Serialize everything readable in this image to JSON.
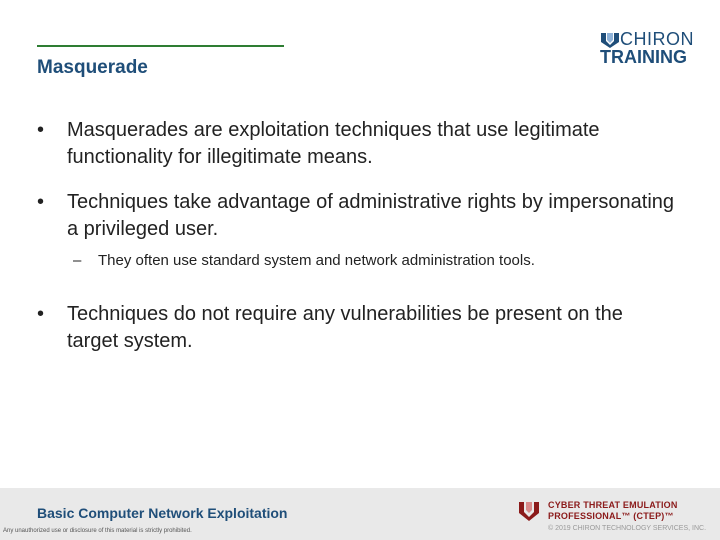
{
  "header": {
    "title": "Masquerade",
    "logo": {
      "top_text": "CHIRON",
      "bottom_text": "TRAINING",
      "mark_icon": "chiron-shield-icon"
    }
  },
  "bullets": [
    {
      "text": "Masquerades are exploitation techniques that use legitimate functionality for illegitimate means."
    },
    {
      "text": "Techniques take advantage of administrative rights by impersonating a privileged user.",
      "sub": "They often use standard system and network administration tools."
    },
    {
      "text": "Techniques do not require any vulnerabilities be present on the target system."
    }
  ],
  "glyphs": {
    "bullet": "•",
    "dash": "–"
  },
  "footer": {
    "course_title": "Basic Computer Network Exploitation",
    "disclaimer": "Any unauthorized use or disclosure of this material is strictly prohibited.",
    "cert_line1": "CYBER THREAT EMULATION",
    "cert_line2": "PROFESSIONAL™ (CTEP)™",
    "copyright": "© 2019 CHIRON TECHNOLOGY SERVICES, INC.",
    "cert_icon": "ctep-shield-icon"
  },
  "colors": {
    "title": "#1f4e79",
    "rule": "#2e7d32",
    "footer_bg": "#e9e9e9",
    "cert": "#8b1a1a"
  }
}
